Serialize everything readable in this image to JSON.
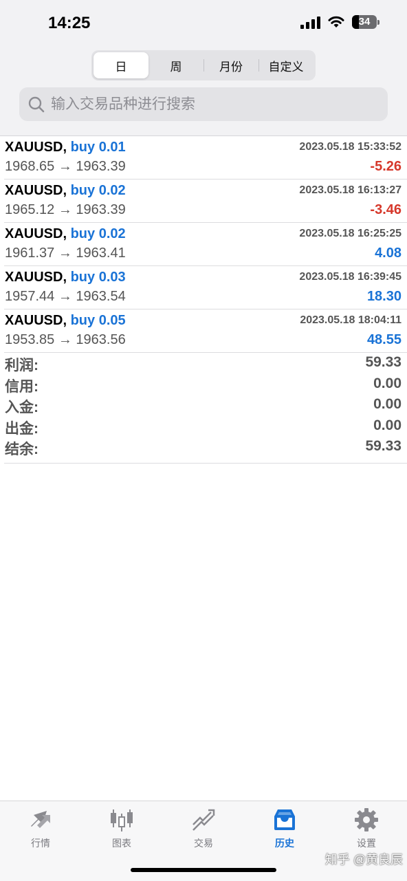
{
  "status_bar": {
    "time": "14:25",
    "battery": "34"
  },
  "period_tabs": [
    {
      "label": "日",
      "active": true
    },
    {
      "label": "周",
      "active": false
    },
    {
      "label": "月份",
      "active": false
    },
    {
      "label": "自定义",
      "active": false
    }
  ],
  "search": {
    "placeholder": "输入交易品种进行搜索",
    "value": ""
  },
  "trades": [
    {
      "symbol": "XAUUSD,",
      "side": "buy 0.01",
      "time": "2023.05.18 15:33:52",
      "prices": "1968.65 → 1963.39",
      "profit": "-5.26"
    },
    {
      "symbol": "XAUUSD,",
      "side": "buy 0.02",
      "time": "2023.05.18 16:13:27",
      "prices": "1965.12 → 1963.39",
      "profit": "-3.46"
    },
    {
      "symbol": "XAUUSD,",
      "side": "buy 0.02",
      "time": "2023.05.18 16:25:25",
      "prices": "1961.37 → 1963.41",
      "profit": "4.08"
    },
    {
      "symbol": "XAUUSD,",
      "side": "buy 0.03",
      "time": "2023.05.18 16:39:45",
      "prices": "1957.44 → 1963.54",
      "profit": "18.30"
    },
    {
      "symbol": "XAUUSD,",
      "side": "buy 0.05",
      "time": "2023.05.18 18:04:11",
      "prices": "1953.85 → 1963.56",
      "profit": "48.55"
    }
  ],
  "summary": [
    {
      "label": "利润:",
      "value": "59.33"
    },
    {
      "label": "信用:",
      "value": "0.00"
    },
    {
      "label": "入金:",
      "value": "0.00"
    },
    {
      "label": "出金:",
      "value": "0.00"
    },
    {
      "label": "结余:",
      "value": "59.33"
    }
  ],
  "tabbar": [
    {
      "label": "行情",
      "icon": "quotes-icon",
      "active": false
    },
    {
      "label": "图表",
      "icon": "chart-icon",
      "active": false
    },
    {
      "label": "交易",
      "icon": "trade-icon",
      "active": false
    },
    {
      "label": "历史",
      "icon": "history-icon",
      "active": true
    },
    {
      "label": "设置",
      "icon": "settings-icon",
      "active": false
    }
  ],
  "watermark": "知乎 @黄良辰",
  "colors": {
    "accent": "#1a73d6",
    "negative": "#d6382b",
    "tab_inactive": "#7a7a7f"
  }
}
